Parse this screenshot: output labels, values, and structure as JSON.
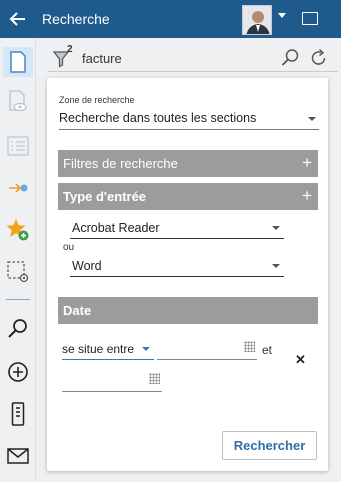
{
  "header": {
    "title": "Recherche"
  },
  "search": {
    "filter_count": "2",
    "value": "facture"
  },
  "zone": {
    "label": "Zone de recherche",
    "value": "Recherche dans toutes les sections"
  },
  "sections": {
    "filters": "Filtres de recherche",
    "type": "Type d'entrée",
    "date": "Date"
  },
  "type_entries": {
    "first": "Acrobat Reader",
    "connector": "ou",
    "second": "Word"
  },
  "date": {
    "operator": "se situe entre",
    "connector": "et",
    "value1": "",
    "value2": ""
  },
  "actions": {
    "search_button": "Rechercher"
  },
  "colors": {
    "header": "#1f5a8c",
    "accent": "#2f7bbd",
    "section": "#9c9c9c",
    "star": "#f0a21b"
  }
}
